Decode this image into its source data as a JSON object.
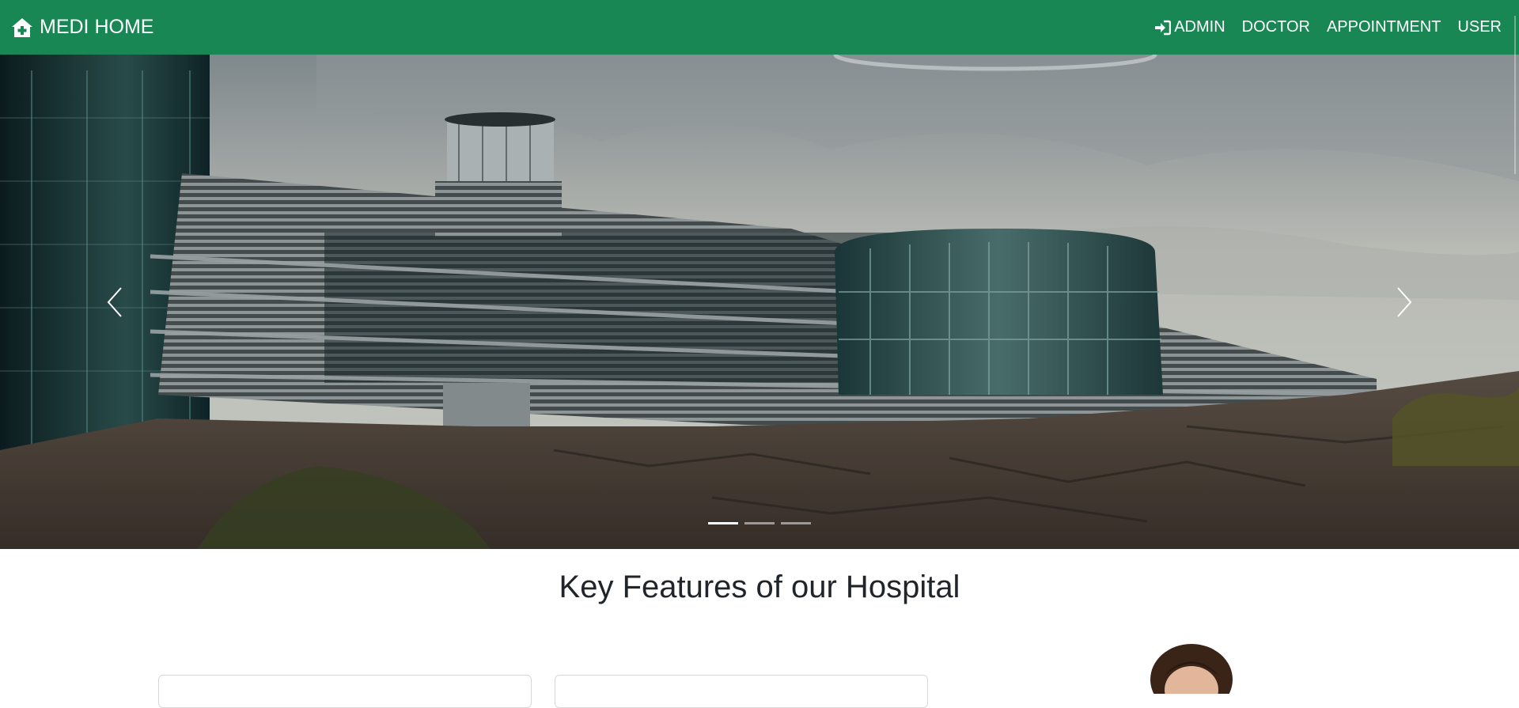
{
  "navbar": {
    "brand": {
      "icon": "house-medical-icon",
      "label": "MEDI HOME"
    },
    "links": [
      {
        "label": "ADMIN",
        "icon": "sign-in-icon"
      },
      {
        "label": "DOCTOR"
      },
      {
        "label": "APPOINTMENT"
      },
      {
        "label": "USER"
      }
    ],
    "background_color": "#198754"
  },
  "carousel": {
    "prev_icon": "chevron-left-icon",
    "next_icon": "chevron-right-icon",
    "indicator_count": 3,
    "active_index": 0
  },
  "features": {
    "title": "Key Features of our Hospital"
  }
}
